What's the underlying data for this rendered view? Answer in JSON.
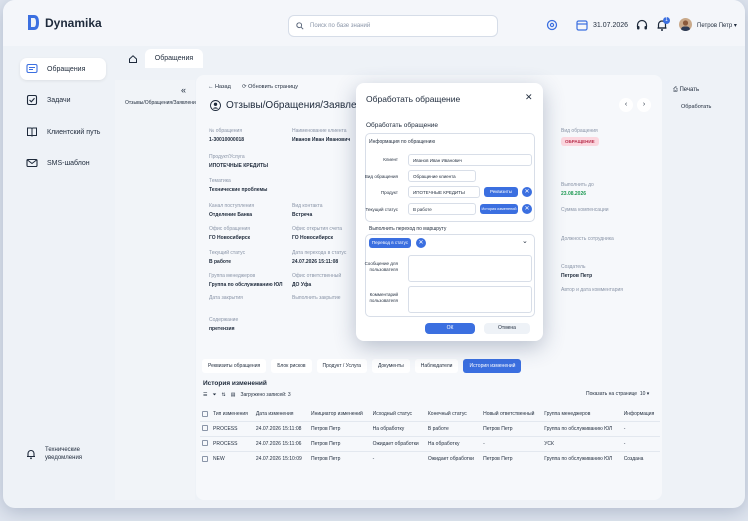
{
  "app": {
    "name": "Dynamika"
  },
  "header": {
    "search_placeholder": "Поиск по базе знаний",
    "date": "31.07.2026",
    "notification_count": "1",
    "user_name": "Петров Петр"
  },
  "sidebar": {
    "items": [
      {
        "label": "Обращения"
      },
      {
        "label": "Задачи"
      },
      {
        "label": "Клиентский путь"
      },
      {
        "label": "SMS-шаблон"
      }
    ],
    "bottom_label_1": "Технические",
    "bottom_label_2": "уведомления"
  },
  "top_tab": "Обращения",
  "tree": {
    "item": "Отзывы/Обращения/Заявления"
  },
  "main": {
    "back": "Назад",
    "refresh": "Обновить страницу",
    "title": "Отзывы/Обращения/Заявления",
    "fields": {
      "num_label": "№ обращения",
      "num_value": "1-30010000018",
      "client_label": "Наименование клиента",
      "client_value": "Иванов Иван Иванович",
      "product_label": "Продукт/Услуга",
      "product_value": "ИПОТЕЧНЫЕ КРЕДИТЫ",
      "theme_label": "Тематика",
      "theme_value": "Технические проблемы",
      "channel_label": "Канал поступления",
      "channel_value": "Отделение Банка",
      "contact_label": "Вид контакта",
      "contact_value": "Встреча",
      "office_label": "Офис обращения",
      "office_value": "ГО Новосибирск",
      "open_office_label": "Офис открытия счета",
      "open_office_value": "ГО Новосибирск",
      "status_label": "Текущий статус",
      "status_value": "В работе",
      "status_date_label": "Дата перехода в статус",
      "status_date_value": "24.07.2026 15:11:08",
      "mgr_group_label": "Группа менеджеров",
      "mgr_group_value": "Группа по обслуживанию ЮЛ",
      "resp_office_label": "Офис ответственный",
      "resp_office_value": "ДО Уфа",
      "close_date_label": "Дата закрытия",
      "close_exec_label": "Выполнить закрытие",
      "content_label": "Содержание",
      "content_value": "претензия",
      "type_label": "Вид обращения",
      "type_value": "ОБРАЩЕНИЕ",
      "done_by_label": "Выполнить до",
      "done_by_value": "23.08.2026",
      "comp_label": "Сумма компенсации",
      "position_label": "Должность сотрудника",
      "creator_label": "Создатель",
      "creator_value": "Петров Петр",
      "comment_author_label": "Автор и дата комментария"
    },
    "subtabs": [
      "Реквизиты обращения",
      "Блок рисков",
      "Продукт / Услуга",
      "Документы",
      "Наблюдатели",
      "История изменений"
    ],
    "history_title": "История изменений",
    "loaded": "Загружено записей: 3",
    "per_page_label": "Показать на странице",
    "per_page_value": "10",
    "columns": [
      "Тип изменения",
      "Дата изменения",
      "Инициатор изменений",
      "Исходный статус",
      "Конечный статус",
      "Новый ответственный",
      "Группа менеджеров",
      "Информация"
    ],
    "rows": [
      [
        "PROCESS",
        "24.07.2026 15:11:08",
        "Петров Петр",
        "На обработку",
        "В работе",
        "Петров Петр",
        "Группа по обслуживанию ЮЛ",
        "-"
      ],
      [
        "PROCESS",
        "24.07.2026 15:11:06",
        "Петров Петр",
        "Ожидает обработки",
        "На обработку",
        "-",
        "УСК",
        "-"
      ],
      [
        "NEW",
        "24.07.2026 15:10:09",
        "Петров Петр",
        "-",
        "Ожидает обработки",
        "Петров Петр",
        "Группа по обслуживанию ЮЛ",
        "Создана"
      ]
    ]
  },
  "right": {
    "print": "Печать",
    "process": "Обработать"
  },
  "modal": {
    "title": "Обработать обращение",
    "section": "Обработать обращение",
    "info_title": "Информация по обращению",
    "client_label": "Клиент",
    "client_value": "Иванов Иван Иванович",
    "type_label": "Вид обращения",
    "type_value": "Обращение клиента",
    "product_label": "Продукт",
    "product_value": "ИПОТЕЧНЫЕ КРЕДИТЫ",
    "requisites_btn": "Реквизиты",
    "status_label": "Текущий статус",
    "status_value": "В работе",
    "history_btn": "История изменений",
    "route_title": "Выполнить переход по маршруту",
    "route_chip": "Перевод в статус",
    "msg_label": "Сообщение для пользователя",
    "comment_label": "Комментарий пользователя",
    "ok": "ОК",
    "cancel": "Отмена"
  }
}
